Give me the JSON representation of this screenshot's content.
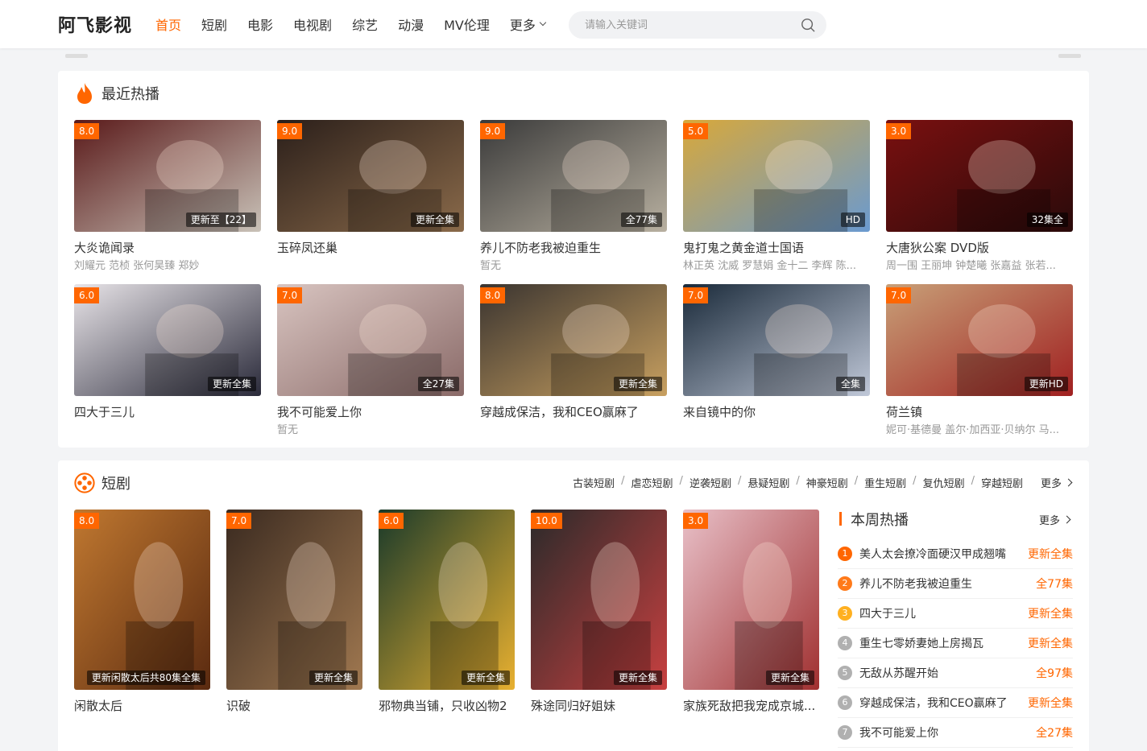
{
  "site": {
    "logo": "阿飞影视"
  },
  "nav": {
    "items": [
      {
        "label": "首页",
        "active": true
      },
      {
        "label": "短剧",
        "active": false
      },
      {
        "label": "电影",
        "active": false
      },
      {
        "label": "电视剧",
        "active": false
      },
      {
        "label": "综艺",
        "active": false
      },
      {
        "label": "动漫",
        "active": false
      },
      {
        "label": "MV伦理",
        "active": false
      }
    ],
    "more_label": "更多"
  },
  "search": {
    "placeholder": "请输入关键词",
    "value": ""
  },
  "hot": {
    "title": "最近热播",
    "cards": [
      {
        "title": "大炎诡闻录",
        "score": "8.0",
        "badge": "更新至【22】",
        "actors": "刘耀元 范桢 张何昊臻 郑妙",
        "colors": [
          "#5a1a1a",
          "#c9c2b8"
        ]
      },
      {
        "title": "玉碎凤还巢",
        "score": "9.0",
        "badge": "更新全集",
        "actors": "",
        "colors": [
          "#2b1f1a",
          "#8a6a4a"
        ]
      },
      {
        "title": "养儿不防老我被迫重生",
        "score": "9.0",
        "badge": "全77集",
        "actors": "暂无",
        "colors": [
          "#3a3a3a",
          "#b8b0a0"
        ]
      },
      {
        "title": "鬼打鬼之黄金道士国语",
        "score": "5.0",
        "badge": "HD",
        "actors": "林正英 沈威 罗慧娟 金十二 李辉 陈...",
        "colors": [
          "#d8a83a",
          "#6a9ad0"
        ]
      },
      {
        "title": "大唐狄公案 DVD版",
        "score": "3.0",
        "badge": "32集全",
        "actors": "周一围 王丽坤 钟楚曦 张嘉益 张若...",
        "colors": [
          "#7a1010",
          "#2a0a0a"
        ]
      },
      {
        "title": "四大于三儿",
        "score": "6.0",
        "badge": "更新全集",
        "actors": "",
        "colors": [
          "#e8e4e8",
          "#2a2a3a"
        ]
      },
      {
        "title": "我不可能爱上你",
        "score": "7.0",
        "badge": "全27集",
        "actors": "暂无",
        "colors": [
          "#d8c4c0",
          "#8a6a68"
        ]
      },
      {
        "title": "穿越成保洁，我和CEO赢麻了",
        "score": "8.0",
        "badge": "更新全集",
        "actors": "",
        "colors": [
          "#3a3430",
          "#c8a060"
        ]
      },
      {
        "title": "来自镜中的你",
        "score": "7.0",
        "badge": "全集",
        "actors": "",
        "colors": [
          "#1a2a3a",
          "#c0c8d8"
        ]
      },
      {
        "title": "荷兰镇",
        "score": "7.0",
        "badge": "更新HD",
        "actors": "妮可·基德曼 盖尔·加西亚·贝纳尔 马...",
        "colors": [
          "#c8a078",
          "#a02020"
        ]
      }
    ]
  },
  "short": {
    "title": "短剧",
    "tags": [
      "古装短剧",
      "虐恋短剧",
      "逆袭短剧",
      "悬疑短剧",
      "神豪短剧",
      "重生短剧",
      "复仇短剧",
      "穿越短剧"
    ],
    "more_label": "更多",
    "cards": [
      {
        "title": "闲散太后",
        "score": "8.0",
        "badge": "更新闲散太后共80集全集",
        "colors": [
          "#c07830",
          "#5a2a10"
        ]
      },
      {
        "title": "识破",
        "score": "7.0",
        "badge": "更新全集",
        "colors": [
          "#3a2a20",
          "#a07850"
        ]
      },
      {
        "title": "邪物典当铺，只收凶物2",
        "score": "6.0",
        "badge": "更新全集",
        "colors": [
          "#1a3a2a",
          "#e8b030"
        ]
      },
      {
        "title": "殊途同归好姐妹",
        "score": "10.0",
        "badge": "更新全集",
        "colors": [
          "#2a2a2a",
          "#c84040"
        ]
      },
      {
        "title": "家族死敌把我宠成京城...",
        "score": "3.0",
        "badge": "更新全集",
        "colors": [
          "#e8c0c8",
          "#a03030"
        ]
      }
    ]
  },
  "rank": {
    "title": "本周热播",
    "more_label": "更多",
    "items": [
      {
        "num": "1",
        "name": "美人太会撩冷面硬汉甲成翘嘴",
        "status": "更新全集",
        "color": "#ff6600"
      },
      {
        "num": "2",
        "name": "养儿不防老我被迫重生",
        "status": "全77集",
        "color": "#ff7a1a"
      },
      {
        "num": "3",
        "name": "四大于三儿",
        "status": "更新全集",
        "color": "#ffb020"
      },
      {
        "num": "4",
        "name": "重生七零娇妻她上房揭瓦",
        "status": "更新全集",
        "color": "#b0b0b0"
      },
      {
        "num": "5",
        "name": "无敌从苏醒开始",
        "status": "全97集",
        "color": "#b0b0b0"
      },
      {
        "num": "6",
        "name": "穿越成保洁，我和CEO赢麻了",
        "status": "更新全集",
        "color": "#b0b0b0"
      },
      {
        "num": "7",
        "name": "我不可能爱上你",
        "status": "全27集",
        "color": "#b0b0b0"
      }
    ]
  }
}
